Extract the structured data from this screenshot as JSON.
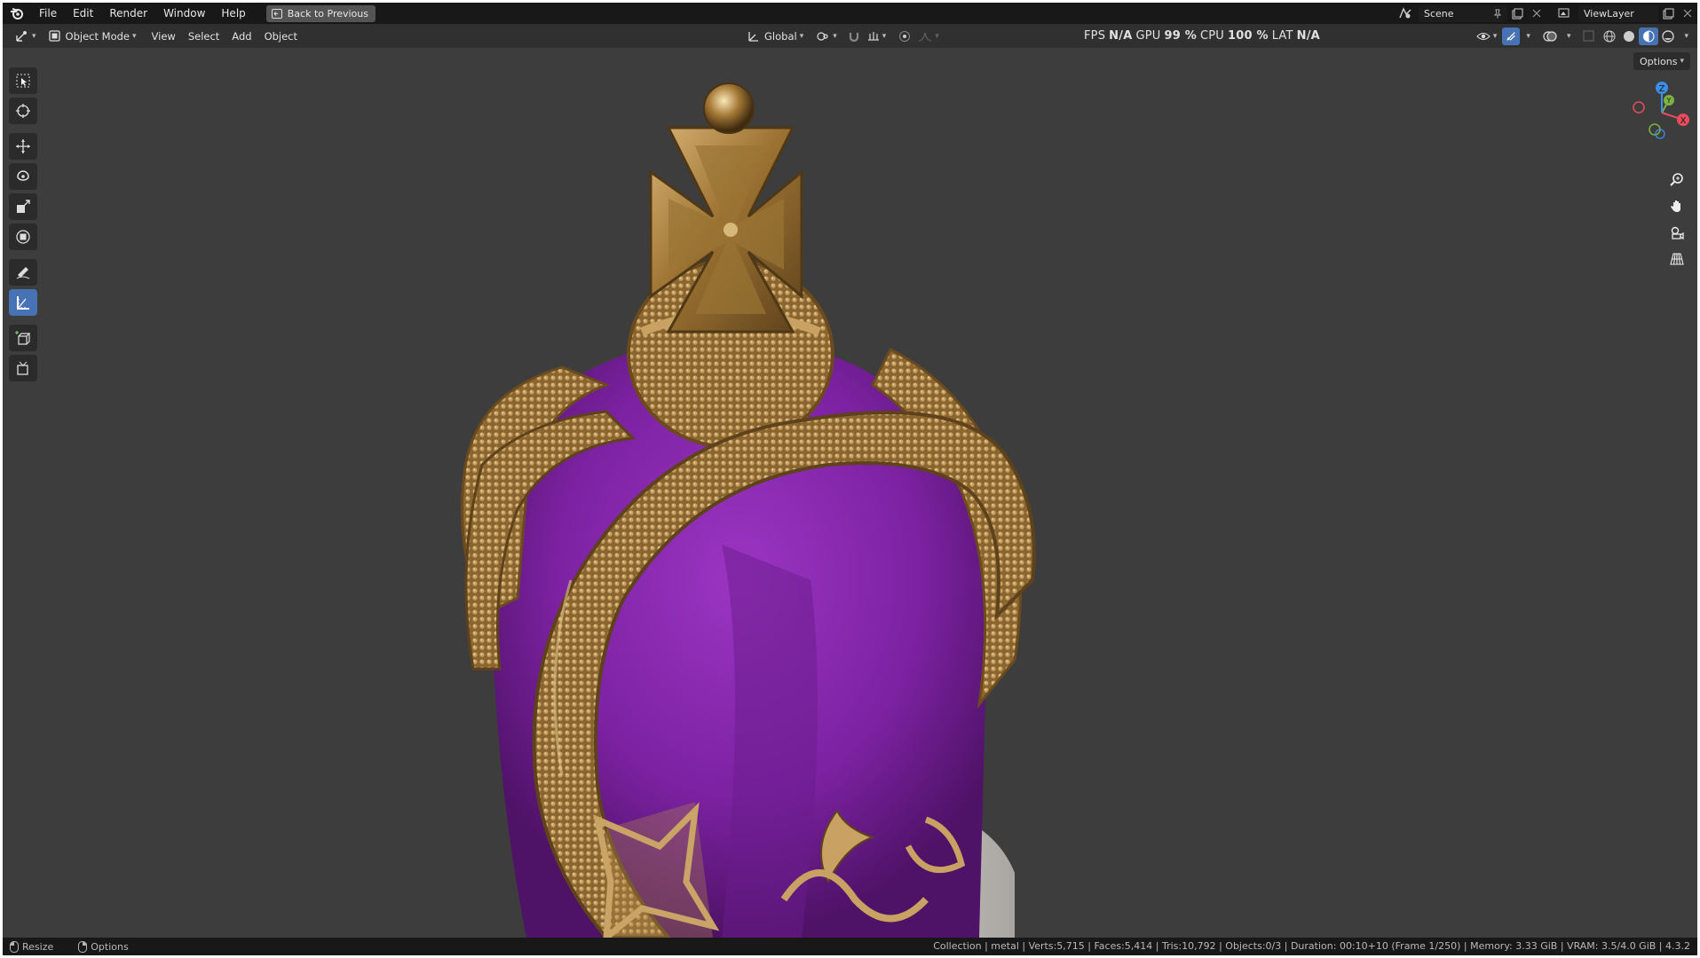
{
  "menu": {
    "items": [
      "File",
      "Edit",
      "Render",
      "Window",
      "Help"
    ],
    "back_button": "Back to Previous"
  },
  "topright": {
    "scene": "Scene",
    "view_layer": "ViewLayer"
  },
  "header": {
    "mode": "Object Mode",
    "menus": [
      "View",
      "Select",
      "Add",
      "Object"
    ],
    "orientation": "Global"
  },
  "stats": {
    "fps_label": "FPS",
    "fps_value": "N/A",
    "gpu_label": "GPU",
    "gpu_value": "99 %",
    "cpu_label": "CPU",
    "cpu_value": "100 %",
    "lat_label": "LAT",
    "lat_value": "N/A"
  },
  "viewport": {
    "options": "Options",
    "gizmo_axes": [
      "X",
      "Y",
      "Z"
    ]
  },
  "status": {
    "left": [
      "Resize",
      "Options"
    ],
    "right": "Collection | metal | Verts:5,715 | Faces:5,414 | Tris:10,792 | Objects:0/3 | Duration: 00:10+10 (Frame 1/250) | Memory: 3.33 GiB | VRAM: 3.5/4.0 GiB | 4.3.2"
  },
  "colors": {
    "accent": "#4772b3",
    "velvet": "#8e2bb5",
    "gold": "#b58a45",
    "axis_x": "#e84b5c",
    "axis_y": "#7ab33f",
    "axis_z": "#3d8ee8"
  }
}
